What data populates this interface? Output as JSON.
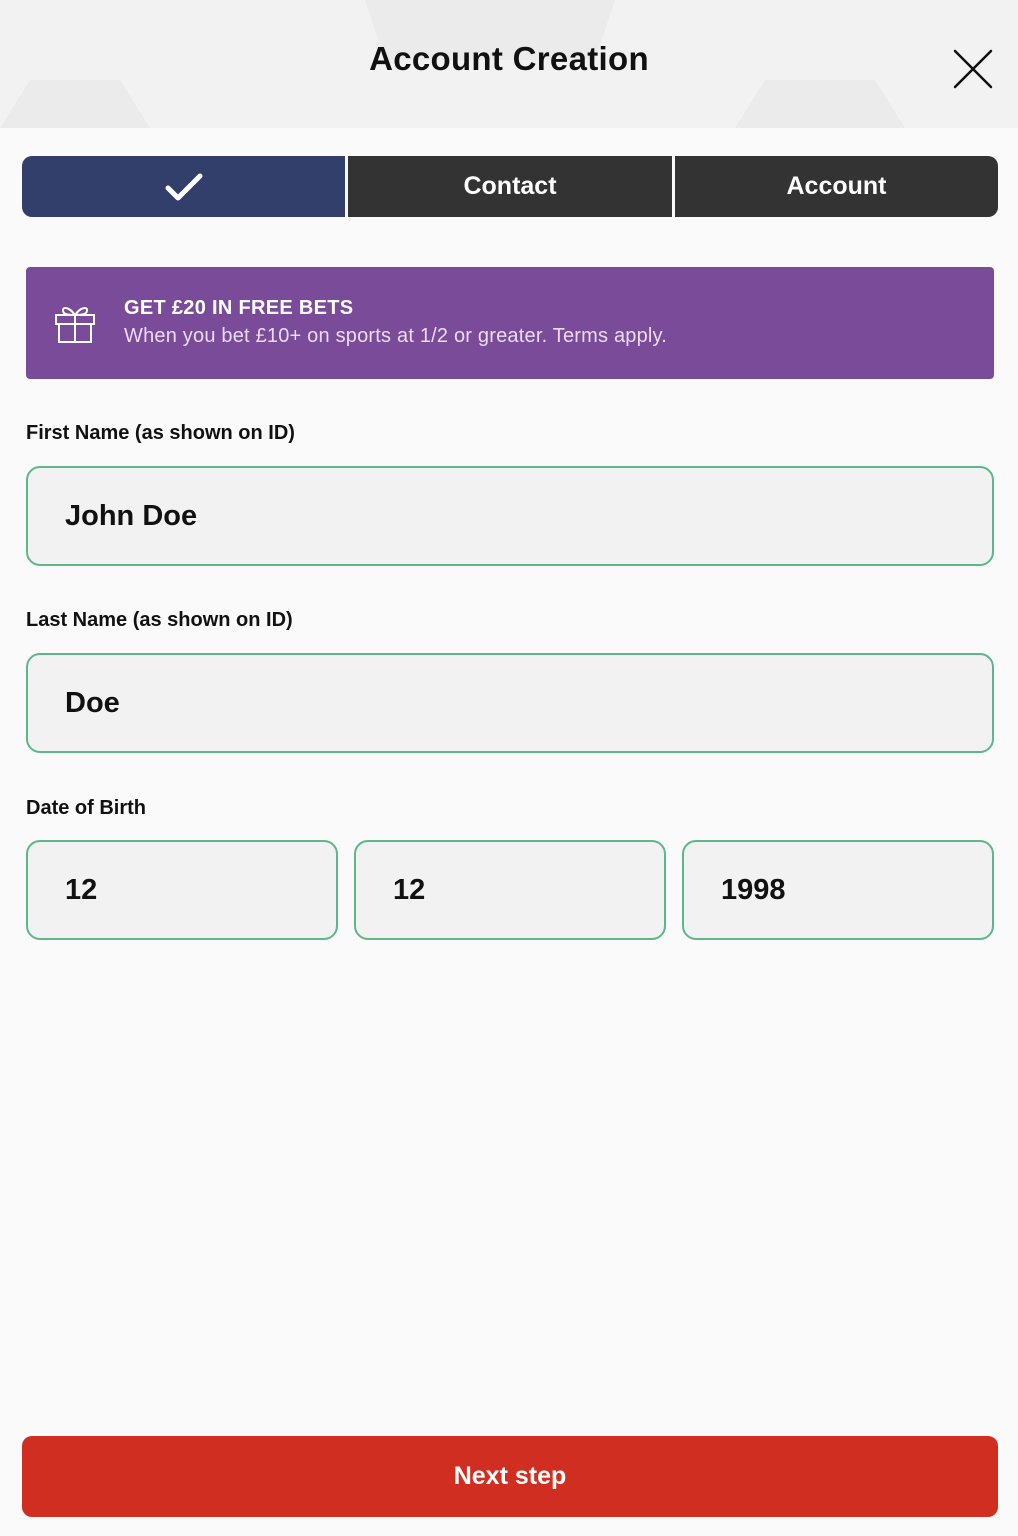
{
  "header": {
    "title": "Account Creation",
    "close_icon": "close-icon"
  },
  "stepper": {
    "steps": [
      {
        "label": "",
        "icon": "check-icon",
        "state": "completed"
      },
      {
        "label": "Contact",
        "state": "pending"
      },
      {
        "label": "Account",
        "state": "pending"
      }
    ]
  },
  "promo": {
    "icon": "gift-icon",
    "headline": "GET £20 IN FREE BETS",
    "subtext": "When you bet £10+ on sports at 1/2 or greater. Terms apply."
  },
  "form": {
    "first_name": {
      "label": "First Name (as shown on ID)",
      "value": "John Doe"
    },
    "last_name": {
      "label": "Last Name (as shown on ID)",
      "value": "Doe"
    },
    "dob": {
      "label": "Date of Birth",
      "day": "12",
      "month": "12",
      "year": "1998"
    }
  },
  "actions": {
    "next_label": "Next step"
  },
  "colors": {
    "stepper_done": "#333f6b",
    "stepper_pending": "#333333",
    "promo_bg": "#7a4b99",
    "field_border": "#5cb88a",
    "primary_button": "#d12e22"
  }
}
